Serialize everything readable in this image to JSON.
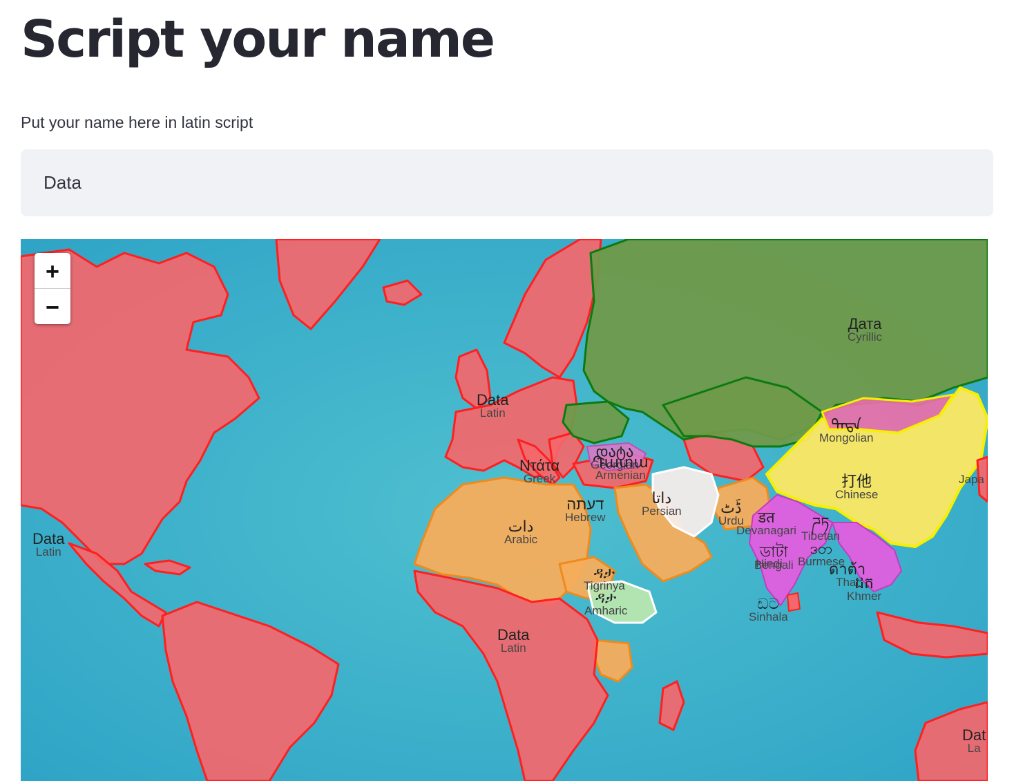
{
  "page": {
    "title": "Script your name",
    "input_label": "Put your name here in latin script",
    "input_value": "Data"
  },
  "map": {
    "zoom_in": "+",
    "zoom_out": "−",
    "labels": [
      {
        "id": "latin-europe",
        "main": "Data",
        "sub": "Latin"
      },
      {
        "id": "latin-america",
        "main": "Data",
        "sub": "Latin"
      },
      {
        "id": "latin-africa",
        "main": "Data",
        "sub": "Latin"
      },
      {
        "id": "latin-australia",
        "main": "Dat",
        "sub": "La"
      },
      {
        "id": "cyrillic",
        "main": "Дата",
        "sub": "Cyrillic"
      },
      {
        "id": "greek",
        "main": "Ντάτα",
        "sub": "Greek"
      },
      {
        "id": "georgian",
        "main": "დატა",
        "sub": "Georgian"
      },
      {
        "id": "armenian",
        "main": "Դատա",
        "sub": "Armenian"
      },
      {
        "id": "hebrew",
        "main": "דעתה",
        "sub": "Hebrew"
      },
      {
        "id": "arabic",
        "main": "دات",
        "sub": "Arabic"
      },
      {
        "id": "persian",
        "main": "داتا",
        "sub": "Persian"
      },
      {
        "id": "urdu",
        "main": "ڈَٹ",
        "sub": "Urdu"
      },
      {
        "id": "tigrinya",
        "main": "ዳታ",
        "sub": "Tigrinya"
      },
      {
        "id": "amharic",
        "main": "ዳታ",
        "sub": "Amharic"
      },
      {
        "id": "mongolian",
        "main": "ᠳᠠᠲᠠ",
        "sub": "Mongolian"
      },
      {
        "id": "chinese",
        "main": "打他",
        "sub": "Chinese"
      },
      {
        "id": "japanese",
        "main": "",
        "sub": "Japa"
      },
      {
        "id": "devanagari",
        "main": "डत",
        "sub": "Devanagari"
      },
      {
        "id": "tibetan",
        "main": "ཌཏ",
        "sub": "Tibetan"
      },
      {
        "id": "bengali",
        "main": "ডাটা",
        "sub": "Bengali"
      },
      {
        "id": "hindi",
        "main": "",
        "sub": "Hindi"
      },
      {
        "id": "burmese",
        "main": "ဒတ",
        "sub": "Burmese"
      },
      {
        "id": "thai",
        "main": "ดาต้า",
        "sub": "Thai"
      },
      {
        "id": "khmer",
        "main": "ដត",
        "sub": "Khmer"
      },
      {
        "id": "sinhala",
        "main": "ඩට",
        "sub": "Sinhala"
      }
    ]
  },
  "colors": {
    "latin": "#f4676b",
    "cyrillic": "#6f9a4a",
    "arabic": "#f6ad5c",
    "chinese": "#fbe764",
    "indic": "#e65ce0",
    "ocean": "#3fb3c7"
  }
}
